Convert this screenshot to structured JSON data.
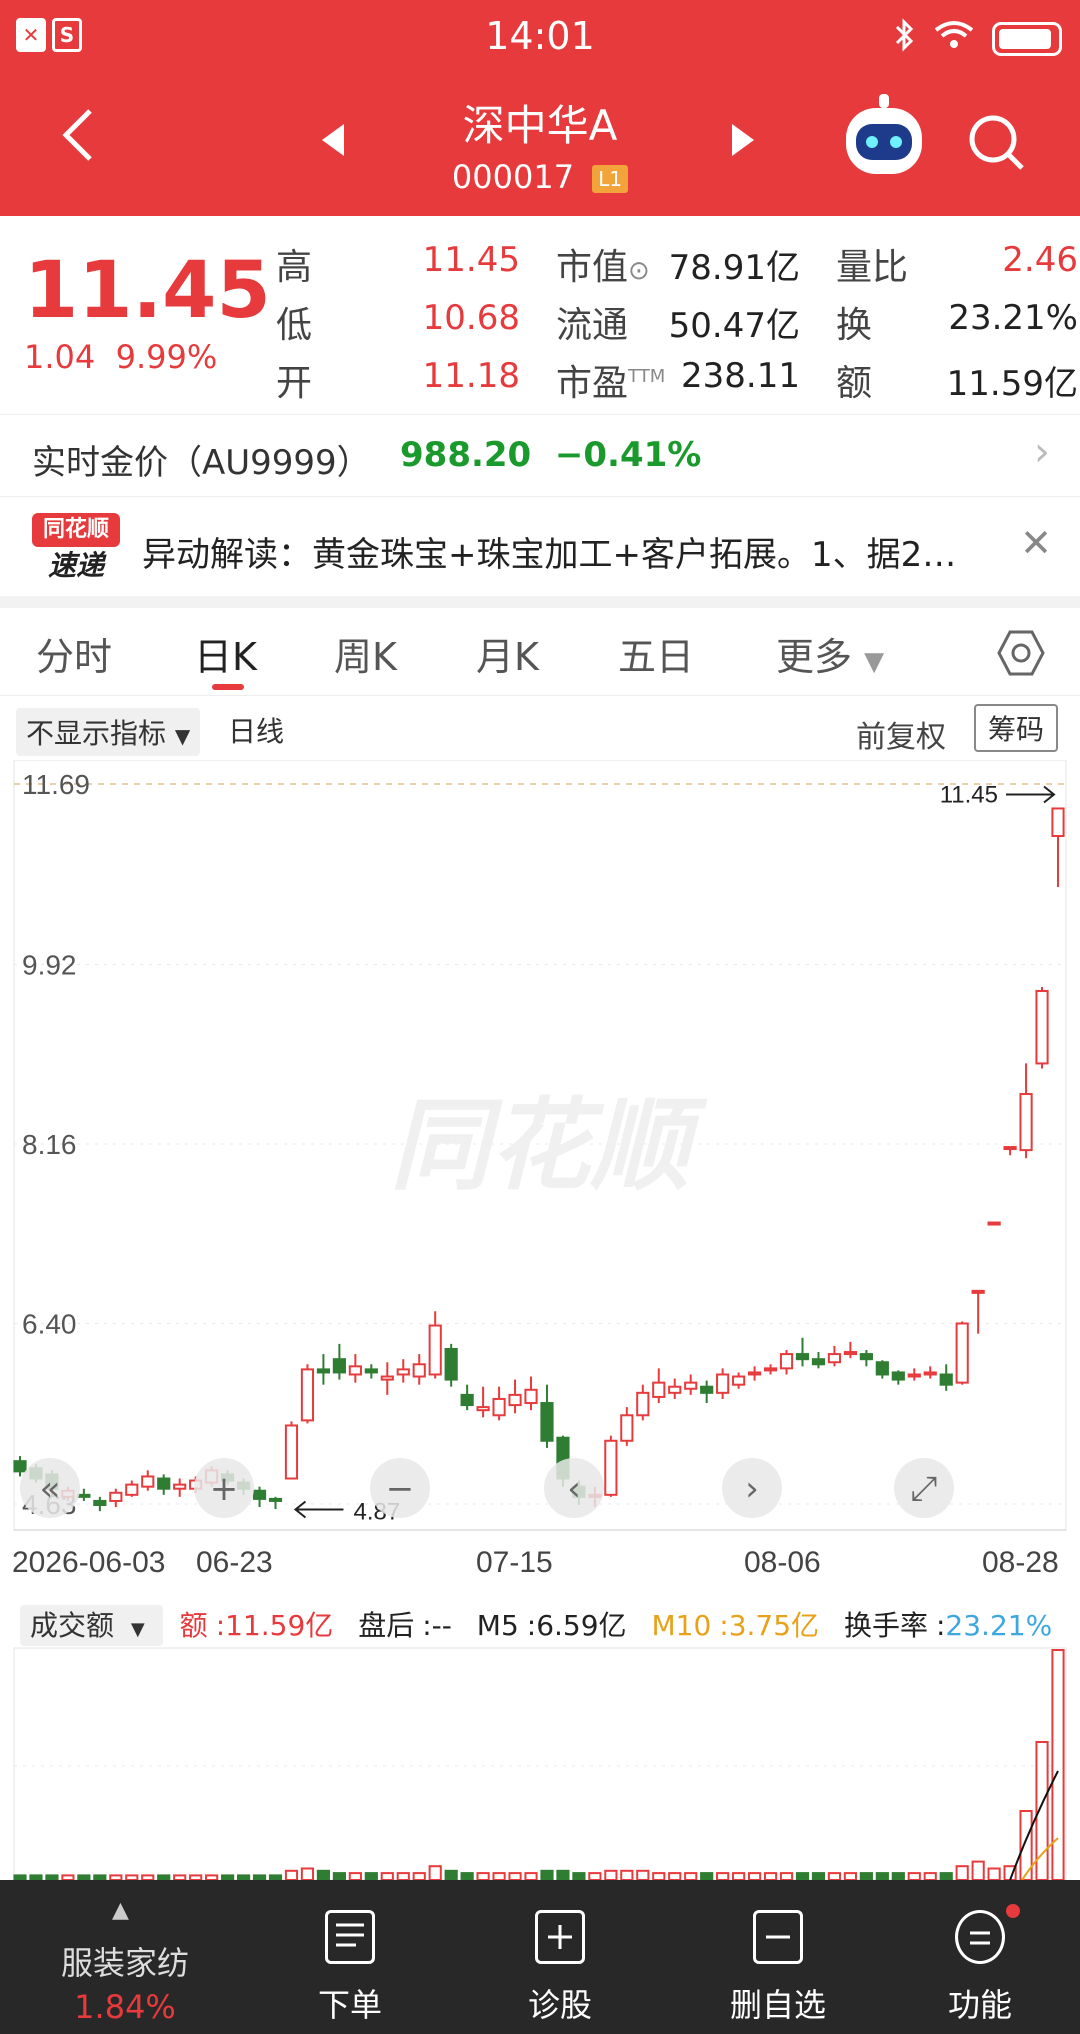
{
  "status_bar": {
    "time": "14:01",
    "left_icons": [
      "✕",
      "S"
    ]
  },
  "header": {
    "stock_name": "深中华A",
    "stock_code": "000017",
    "level_badge": "L1"
  },
  "quote": {
    "price": "11.45",
    "change": "1.04",
    "change_pct": "9.99%",
    "fields": [
      {
        "label": "高",
        "value": "11.45"
      },
      {
        "label": "低",
        "value": "10.68"
      },
      {
        "label": "开",
        "value": "11.18"
      },
      {
        "label": "市值",
        "value": "78.91亿"
      },
      {
        "label": "流通",
        "value": "50.47亿"
      },
      {
        "label": "市盈",
        "label_suffix": "TTM",
        "value": "238.11"
      },
      {
        "label": "量比",
        "value": "2.46"
      },
      {
        "label": "换",
        "value": "23.21%"
      },
      {
        "label": "额",
        "value": "11.59亿"
      }
    ]
  },
  "gold": {
    "label": "实时金价（AU9999）",
    "price": "988.20",
    "change": "−0.41%"
  },
  "news": {
    "logo_top": "同花顺",
    "logo_bottom": "速递",
    "text": "异动解读：黄金珠宝+珠宝加工+客户拓展。1、据2…"
  },
  "tabs": [
    "分时",
    "日K",
    "周K",
    "月K",
    "五日",
    "更多"
  ],
  "indicator": {
    "selector": "不显示指标",
    "period": "日线",
    "adjust": "前复权",
    "chips": "筹码"
  },
  "watermark": "同花顺",
  "chart_data": {
    "type": "candlestick",
    "y_ticks": [
      "11.69",
      "9.92",
      "8.16",
      "6.40",
      "4.63"
    ],
    "x_labels": [
      "2026-06-03",
      "06-23",
      "07-15",
      "08-06",
      "08-28"
    ],
    "max_label": "11.45",
    "min_label": "4.87",
    "ylim": [
      4.63,
      11.69
    ],
    "candles": [
      {
        "o": 5.05,
        "c": 4.95,
        "h": 5.1,
        "l": 4.9
      },
      {
        "o": 4.98,
        "c": 4.88,
        "h": 5.02,
        "l": 4.84
      },
      {
        "o": 4.92,
        "c": 4.78,
        "h": 4.96,
        "l": 4.7
      },
      {
        "o": 4.7,
        "c": 4.76,
        "h": 4.8,
        "l": 4.66
      },
      {
        "o": 4.72,
        "c": 4.7,
        "h": 4.78,
        "l": 4.66
      },
      {
        "o": 4.66,
        "c": 4.62,
        "h": 4.7,
        "l": 4.56
      },
      {
        "o": 4.66,
        "c": 4.74,
        "h": 4.78,
        "l": 4.6
      },
      {
        "o": 4.72,
        "c": 4.82,
        "h": 4.86,
        "l": 4.7
      },
      {
        "o": 4.8,
        "c": 4.9,
        "h": 4.96,
        "l": 4.76
      },
      {
        "o": 4.88,
        "c": 4.78,
        "h": 4.92,
        "l": 4.72
      },
      {
        "o": 4.78,
        "c": 4.82,
        "h": 4.88,
        "l": 4.7
      },
      {
        "o": 4.78,
        "c": 4.86,
        "h": 4.9,
        "l": 4.74
      },
      {
        "o": 4.84,
        "c": 4.96,
        "h": 5.0,
        "l": 4.8
      },
      {
        "o": 4.92,
        "c": 4.86,
        "h": 4.96,
        "l": 4.82
      },
      {
        "o": 4.84,
        "c": 4.78,
        "h": 4.88,
        "l": 4.72
      },
      {
        "o": 4.76,
        "c": 4.68,
        "h": 4.8,
        "l": 4.6
      },
      {
        "o": 4.68,
        "c": 4.66,
        "h": 4.7,
        "l": 4.58
      },
      {
        "o": 4.88,
        "c": 5.4,
        "h": 5.44,
        "l": 4.87
      },
      {
        "o": 5.45,
        "c": 5.95,
        "h": 6.0,
        "l": 5.42
      },
      {
        "o": 5.95,
        "c": 5.92,
        "h": 6.1,
        "l": 5.8
      },
      {
        "o": 6.05,
        "c": 5.92,
        "h": 6.2,
        "l": 5.85
      },
      {
        "o": 5.9,
        "c": 5.98,
        "h": 6.1,
        "l": 5.82
      },
      {
        "o": 5.95,
        "c": 5.92,
        "h": 6.0,
        "l": 5.86
      },
      {
        "o": 5.85,
        "c": 5.88,
        "h": 6.02,
        "l": 5.7
      },
      {
        "o": 5.9,
        "c": 5.95,
        "h": 6.05,
        "l": 5.82
      },
      {
        "o": 5.88,
        "c": 6.0,
        "h": 6.1,
        "l": 5.8
      },
      {
        "o": 5.9,
        "c": 6.38,
        "h": 6.52,
        "l": 5.86
      },
      {
        "o": 6.15,
        "c": 5.85,
        "h": 6.2,
        "l": 5.78
      },
      {
        "o": 5.7,
        "c": 5.6,
        "h": 5.8,
        "l": 5.55
      },
      {
        "o": 5.55,
        "c": 5.58,
        "h": 5.78,
        "l": 5.48
      },
      {
        "o": 5.5,
        "c": 5.66,
        "h": 5.78,
        "l": 5.45
      },
      {
        "o": 5.6,
        "c": 5.7,
        "h": 5.85,
        "l": 5.52
      },
      {
        "o": 5.62,
        "c": 5.75,
        "h": 5.88,
        "l": 5.55
      },
      {
        "o": 5.62,
        "c": 5.25,
        "h": 5.8,
        "l": 5.18
      },
      {
        "o": 5.28,
        "c": 4.88,
        "h": 5.3,
        "l": 4.8
      },
      {
        "o": 4.8,
        "c": 4.7,
        "h": 4.86,
        "l": 4.62
      },
      {
        "o": 4.7,
        "c": 4.72,
        "h": 4.8,
        "l": 4.6
      },
      {
        "o": 4.72,
        "c": 5.25,
        "h": 5.3,
        "l": 4.7
      },
      {
        "o": 5.25,
        "c": 5.5,
        "h": 5.58,
        "l": 5.2
      },
      {
        "o": 5.5,
        "c": 5.72,
        "h": 5.8,
        "l": 5.45
      },
      {
        "o": 5.68,
        "c": 5.82,
        "h": 5.96,
        "l": 5.62
      },
      {
        "o": 5.72,
        "c": 5.78,
        "h": 5.86,
        "l": 5.66
      },
      {
        "o": 5.76,
        "c": 5.82,
        "h": 5.9,
        "l": 5.7
      },
      {
        "o": 5.78,
        "c": 5.72,
        "h": 5.84,
        "l": 5.62
      },
      {
        "o": 5.72,
        "c": 5.9,
        "h": 5.96,
        "l": 5.66
      },
      {
        "o": 5.8,
        "c": 5.88,
        "h": 5.92,
        "l": 5.76
      },
      {
        "o": 5.9,
        "c": 5.92,
        "h": 5.98,
        "l": 5.84
      },
      {
        "o": 5.94,
        "c": 5.96,
        "h": 6.0,
        "l": 5.9
      },
      {
        "o": 5.96,
        "c": 6.1,
        "h": 6.14,
        "l": 5.9
      },
      {
        "o": 6.1,
        "c": 6.05,
        "h": 6.26,
        "l": 5.98
      },
      {
        "o": 6.05,
        "c": 6.0,
        "h": 6.12,
        "l": 5.96
      },
      {
        "o": 6.02,
        "c": 6.1,
        "h": 6.18,
        "l": 5.98
      },
      {
        "o": 6.1,
        "c": 6.12,
        "h": 6.22,
        "l": 6.06
      },
      {
        "o": 6.1,
        "c": 6.05,
        "h": 6.14,
        "l": 5.98
      },
      {
        "o": 6.02,
        "c": 5.9,
        "h": 6.04,
        "l": 5.86
      },
      {
        "o": 5.92,
        "c": 5.85,
        "h": 5.94,
        "l": 5.8
      },
      {
        "o": 5.88,
        "c": 5.9,
        "h": 5.96,
        "l": 5.84
      },
      {
        "o": 5.9,
        "c": 5.92,
        "h": 5.98,
        "l": 5.86
      },
      {
        "o": 5.9,
        "c": 5.8,
        "h": 6.0,
        "l": 5.74
      },
      {
        "o": 5.82,
        "c": 6.4,
        "h": 6.42,
        "l": 5.8
      },
      {
        "o": 6.72,
        "c": 6.72,
        "h": 6.72,
        "l": 6.3
      },
      {
        "o": 7.39,
        "c": 7.39,
        "h": 7.39,
        "l": 7.39
      },
      {
        "o": 8.13,
        "c": 8.13,
        "h": 8.13,
        "l": 8.05
      },
      {
        "o": 8.1,
        "c": 8.65,
        "h": 8.95,
        "l": 8.02
      },
      {
        "o": 8.95,
        "c": 9.66,
        "h": 9.7,
        "l": 8.9
      },
      {
        "o": 11.18,
        "c": 11.45,
        "h": 11.45,
        "l": 10.68
      }
    ]
  },
  "volume": {
    "selector": "成交额",
    "amount_label": "额",
    "amount_value": "11.59亿",
    "after_hours_label": "盘后",
    "after_hours_value": "--",
    "m5_label": "M5",
    "m5_value": "6.59亿",
    "m10_label": "M10",
    "m10_value": "3.75亿",
    "turnover_label": "换手率",
    "turnover_value": "23.21%",
    "bars": [
      0.02,
      0.02,
      0.02,
      0.02,
      0.02,
      0.02,
      0.02,
      0.02,
      0.02,
      0.02,
      0.02,
      0.02,
      0.02,
      0.02,
      0.02,
      0.02,
      0.02,
      0.04,
      0.05,
      0.04,
      0.03,
      0.03,
      0.03,
      0.03,
      0.03,
      0.03,
      0.06,
      0.04,
      0.03,
      0.03,
      0.03,
      0.03,
      0.03,
      0.04,
      0.04,
      0.03,
      0.03,
      0.04,
      0.04,
      0.04,
      0.03,
      0.03,
      0.03,
      0.03,
      0.03,
      0.03,
      0.03,
      0.03,
      0.03,
      0.03,
      0.03,
      0.03,
      0.03,
      0.03,
      0.03,
      0.03,
      0.03,
      0.03,
      0.03,
      0.06,
      0.08,
      0.05,
      0.06,
      0.3,
      0.6,
      1.0
    ],
    "colors": {
      "up": "#e63a3c",
      "down": "#2f7d32",
      "m5": "#111111",
      "m10": "#e8a21a",
      "turnover": "#3fa7e0"
    }
  },
  "bottom_nav": {
    "sector_name": "服装家纺",
    "sector_pct": "1.84%",
    "items": [
      "下单",
      "诊股",
      "删自选",
      "功能"
    ]
  },
  "colors": {
    "brand": "#e63a3c",
    "up": "#e63a3c",
    "down": "#2f7d32",
    "gold_green": "#1a9a2c"
  }
}
